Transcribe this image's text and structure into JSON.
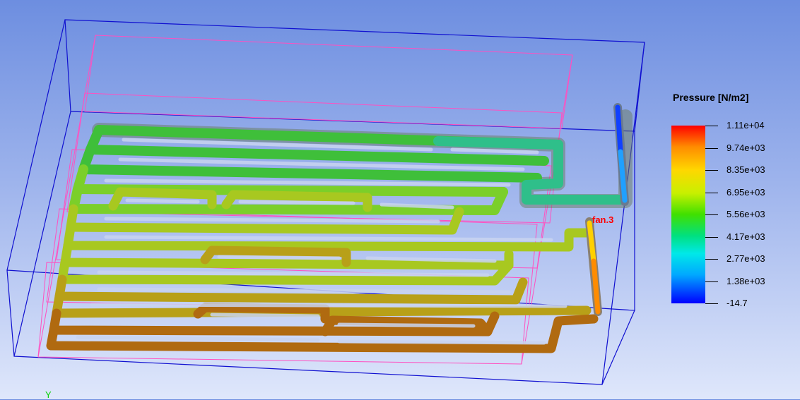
{
  "legend": {
    "title": "Pressure [N/m2]",
    "ticks": [
      "1.11e+04",
      "9.74e+03",
      "8.35e+03",
      "6.95e+03",
      "5.56e+03",
      "4.17e+03",
      "2.77e+03",
      "1.38e+03",
      "-14.7"
    ],
    "colors": {
      "max": "#ff0000",
      "min": "#0000ff"
    }
  },
  "scene": {
    "fan_label": "fan.3",
    "axis_label": "Y"
  }
}
